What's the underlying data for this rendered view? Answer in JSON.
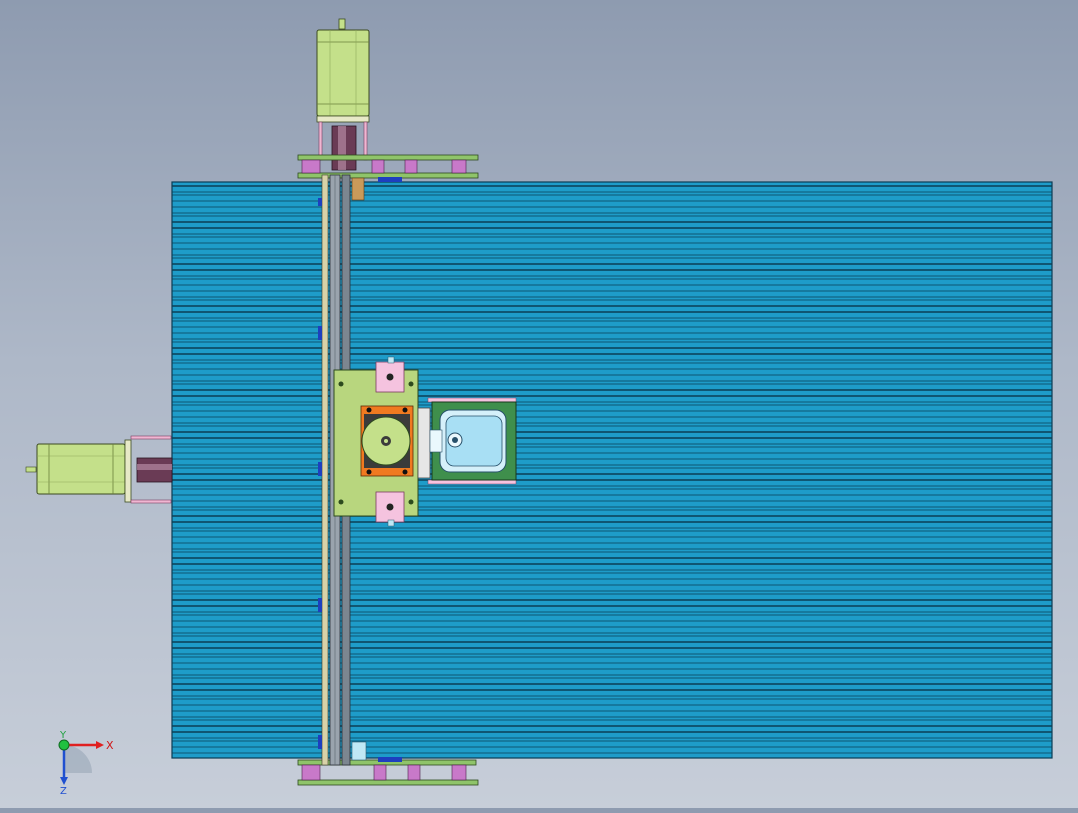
{
  "viewport": {
    "colors": {
      "background_top": "#8e9bb0",
      "background_bottom": "#c7ced9",
      "table_slot": "#1e9cc9",
      "table_slot_dark": "#0b6f93",
      "motor_green": "#c4e08a",
      "bracket_pink": "#f0b6d2",
      "carriage_plate": "#b8d67e",
      "coupling_purple": "#6a3b55",
      "rail_gray": "#9aa3ad",
      "tool_green": "#3f8f4c",
      "tool_cyan": "#a8dff4",
      "orange_block": "#f07a20"
    },
    "components": [
      "aluminum-slot-table",
      "y-axis-stepper-motor",
      "x-axis-stepper-motor",
      "gantry-rail",
      "carriage-plate",
      "spindle-unit",
      "tool-holder"
    ]
  },
  "triad": {
    "x_label": "X",
    "y_label": "Y",
    "z_label": "Z"
  }
}
